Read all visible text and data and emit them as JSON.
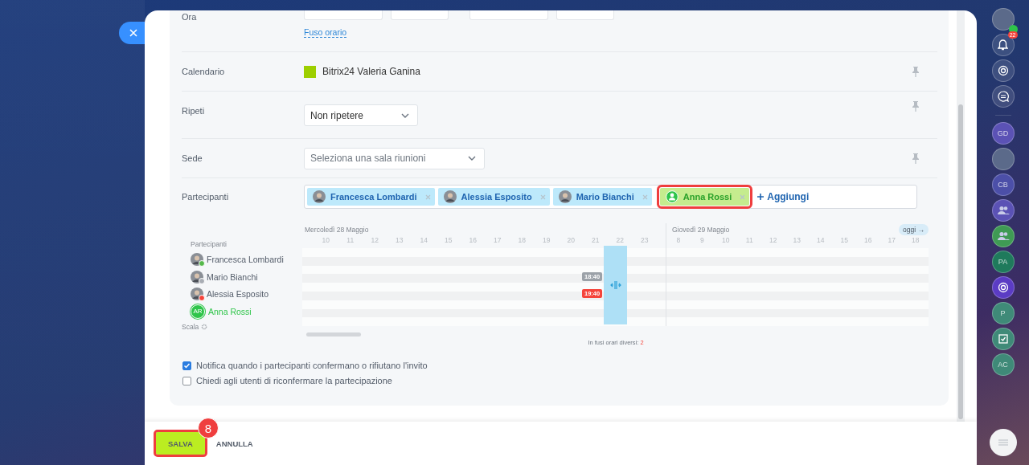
{
  "form": {
    "rows": [
      {
        "kind": "time",
        "label": "Ora",
        "link": "Fuso orario"
      },
      {
        "kind": "calendar",
        "label": "Calendario",
        "value": "Bitrix24 Valeria Ganina",
        "color": "#9dcf00"
      },
      {
        "kind": "select",
        "label": "Ripeti",
        "value": "Non ripetere"
      },
      {
        "kind": "select",
        "label": "Sede",
        "placeholder": "Seleziona una sala riunioni"
      }
    ]
  },
  "participants": {
    "label": "Partecipanti",
    "add_label": "Aggiungi",
    "chips": [
      {
        "name": "Francesca Lombardi",
        "kind": "user",
        "highlighted": false
      },
      {
        "name": "Alessia Esposito",
        "kind": "user",
        "highlighted": false
      },
      {
        "name": "Mario Bianchi",
        "kind": "user",
        "highlighted": false
      },
      {
        "name": "Anna Rossi",
        "kind": "new",
        "highlighted": true
      }
    ]
  },
  "planner": {
    "day_1": {
      "title": "Mercoledì 28 Maggio",
      "hours": [
        "10",
        "11",
        "12",
        "13",
        "14",
        "15",
        "16",
        "17",
        "18",
        "19",
        "20",
        "21",
        "22",
        "23"
      ]
    },
    "day_2": {
      "title": "Giovedì 29 Maggio",
      "hours": [
        "8",
        "9",
        "10",
        "11",
        "12",
        "13",
        "14",
        "15",
        "16",
        "17",
        "18"
      ]
    },
    "today_button": "oggi →",
    "list_title": "Partecipanti",
    "scale_label": "Scala",
    "timezone_note": "In fusi orari diversi:",
    "timezone_count": "2",
    "people": [
      {
        "name": "Francesca Lombardi",
        "kind": "photo",
        "color": "#55b84b"
      },
      {
        "name": "Mario Bianchi",
        "kind": "photo",
        "color": "#a8adb4",
        "busy": {
          "label": "18:40",
          "color": "#9ba1a8"
        }
      },
      {
        "name": "Alessia Esposito",
        "kind": "photo",
        "color": "#f5443b",
        "busy": {
          "label": "19:40",
          "color": "#f5443b"
        }
      },
      {
        "name": "Anna Rossi",
        "kind": "initials",
        "initials": "AR",
        "color": "#2fc54a"
      }
    ]
  },
  "options": [
    {
      "label": "Notifica quando i partecipanti confermano o rifiutano l'invito",
      "checked": true
    },
    {
      "label": "Chiedi agli utenti di riconfermare la partecipazione",
      "checked": false
    }
  ],
  "footer": {
    "buttons": [
      {
        "label": "SALVA",
        "kind": "primary",
        "highlighted": true
      },
      {
        "label": "ANNULLA",
        "kind": "link",
        "highlighted": false
      }
    ],
    "step_badge": "8"
  },
  "rail": [
    {
      "kind": "avatar"
    },
    {
      "kind": "bell",
      "badge": "22"
    },
    {
      "kind": "target"
    },
    {
      "kind": "chat"
    },
    {
      "kind": "divider"
    },
    {
      "kind": "initials",
      "text": "GD",
      "color": "#5b52b5"
    },
    {
      "kind": "avatar"
    },
    {
      "kind": "initials",
      "text": "CB",
      "color": "#4c4fa8"
    },
    {
      "kind": "group",
      "color": "#5b52b5"
    },
    {
      "kind": "group",
      "color": "#3f9a54"
    },
    {
      "kind": "initials",
      "text": "PA",
      "color": "#1f7a5c"
    },
    {
      "kind": "target",
      "color": "#5b3cc4"
    },
    {
      "kind": "initials",
      "text": "P",
      "color": "#3f8a78"
    },
    {
      "kind": "check",
      "color": "#3f8a78"
    },
    {
      "kind": "initials",
      "text": "AC",
      "color": "#3f8a78"
    }
  ]
}
